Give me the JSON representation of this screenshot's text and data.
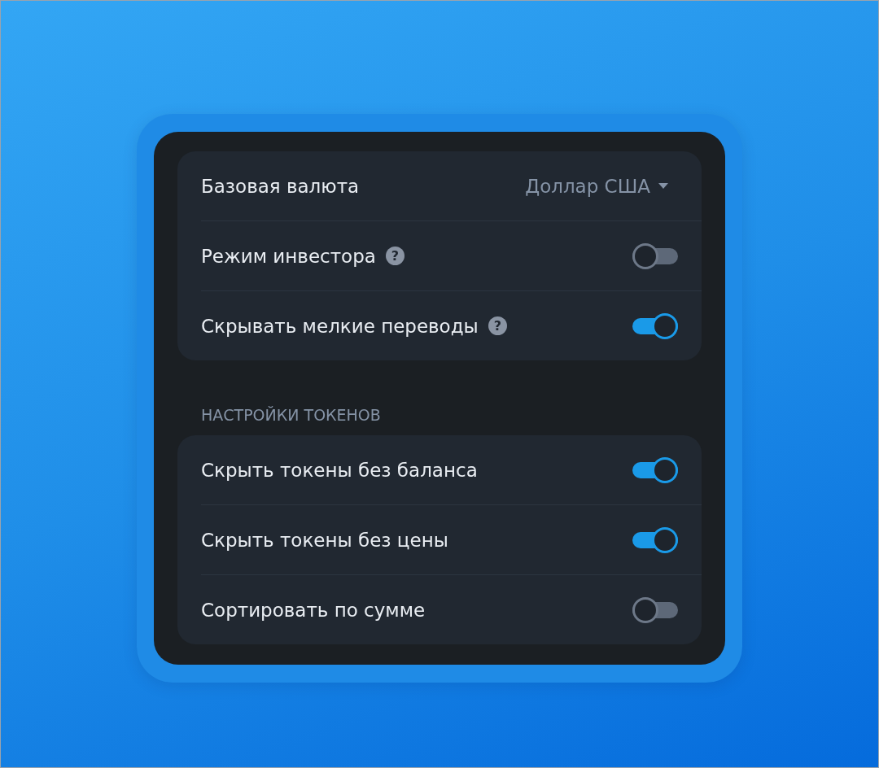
{
  "sections": [
    {
      "rows": [
        {
          "kind": "select",
          "label": "Базовая валюта",
          "value": "Доллар США"
        },
        {
          "kind": "toggle",
          "label": "Режим инвестора",
          "hint": "?",
          "on": false
        },
        {
          "kind": "toggle",
          "label": "Скрывать мелкие переводы",
          "hint": "?",
          "on": true
        }
      ]
    },
    {
      "title": "НАСТРОЙКИ ТОКЕНОВ",
      "rows": [
        {
          "kind": "toggle",
          "label": "Скрыть токены без баланса",
          "on": true
        },
        {
          "kind": "toggle",
          "label": "Скрыть токены без цены",
          "on": true
        },
        {
          "kind": "toggle",
          "label": "Сортировать по сумме",
          "on": false
        }
      ]
    }
  ]
}
